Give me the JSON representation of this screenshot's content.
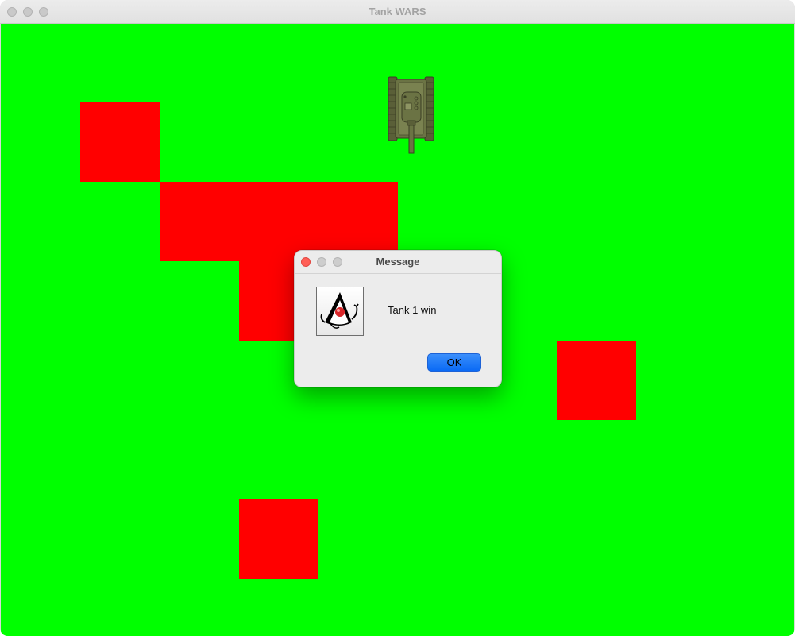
{
  "window": {
    "title": "Tank WARS",
    "controls": [
      "close-button",
      "minimize-button",
      "zoom-button"
    ]
  },
  "game": {
    "background_color": "#00ff00",
    "wall_color": "#ff0000",
    "tank_color": "#6b7344",
    "walls": [
      {
        "label": "wall-1"
      },
      {
        "label": "wall-2"
      },
      {
        "label": "wall-3"
      },
      {
        "label": "wall-4"
      },
      {
        "label": "wall-5"
      }
    ],
    "tanks": [
      {
        "label": "tank",
        "facing": "down"
      }
    ]
  },
  "dialog": {
    "title": "Message",
    "icon": "java-duke-icon",
    "message": "Tank 1 win",
    "ok_label": "OK",
    "accent_color": "#0a6af5"
  }
}
